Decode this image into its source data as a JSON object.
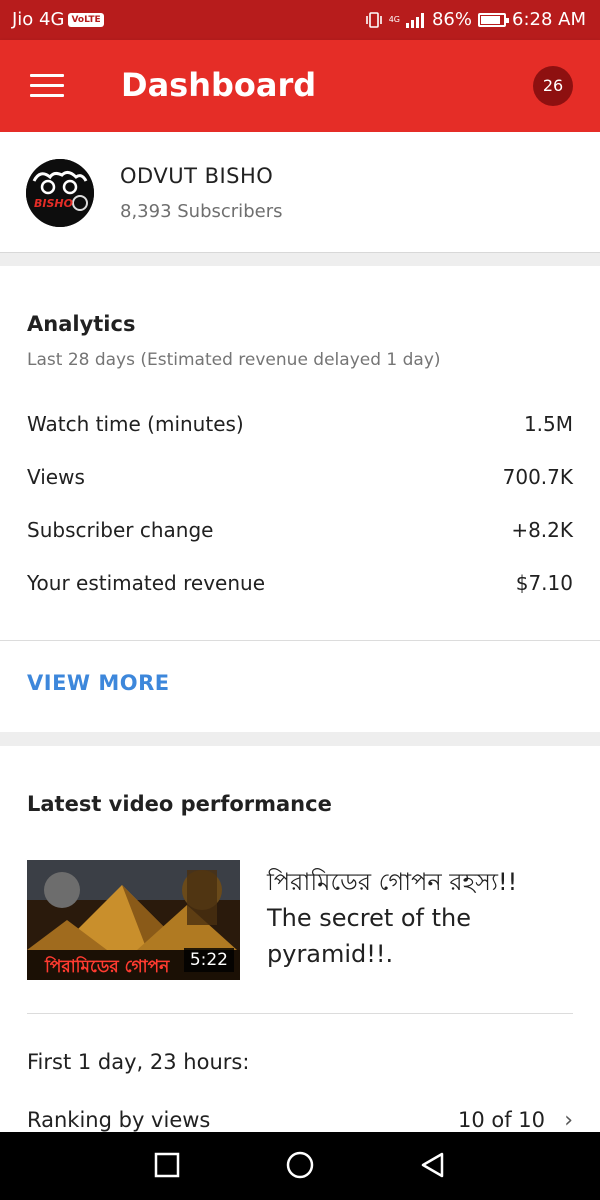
{
  "status_bar": {
    "carrier": "Jio 4G",
    "volte": "VoLTE",
    "network": "4G",
    "battery": "86%",
    "time": "6:28 AM"
  },
  "app_bar": {
    "title": "Dashboard",
    "notifications": "26"
  },
  "channel": {
    "name": "ODVUT BISHO",
    "subscribers": "8,393 Subscribers",
    "avatar_text": "BISHO"
  },
  "analytics": {
    "title": "Analytics",
    "subtitle": "Last 28 days (Estimated revenue delayed 1 day)",
    "rows": [
      {
        "label": "Watch time (minutes)",
        "value": "1.5M"
      },
      {
        "label": "Views",
        "value": "700.7K"
      },
      {
        "label": "Subscriber change",
        "value": "+8.2K"
      },
      {
        "label": "Your estimated revenue",
        "value": "$7.10"
      }
    ],
    "view_more": "VIEW MORE"
  },
  "latest_video": {
    "title": "Latest video performance",
    "video_title": "পিরামিডের গোপন রহস্য!! The secret of the pyramid!!.",
    "thumbnail_text": "পিরামিডের গোপন",
    "duration": "5:22",
    "period": "First 1 day, 23 hours:",
    "ranking_label": "Ranking by views",
    "ranking_value": "10 of 10"
  },
  "nav_bar": {
    "icons": [
      "recents-square-icon",
      "home-circle-icon",
      "back-triangle-icon"
    ]
  }
}
